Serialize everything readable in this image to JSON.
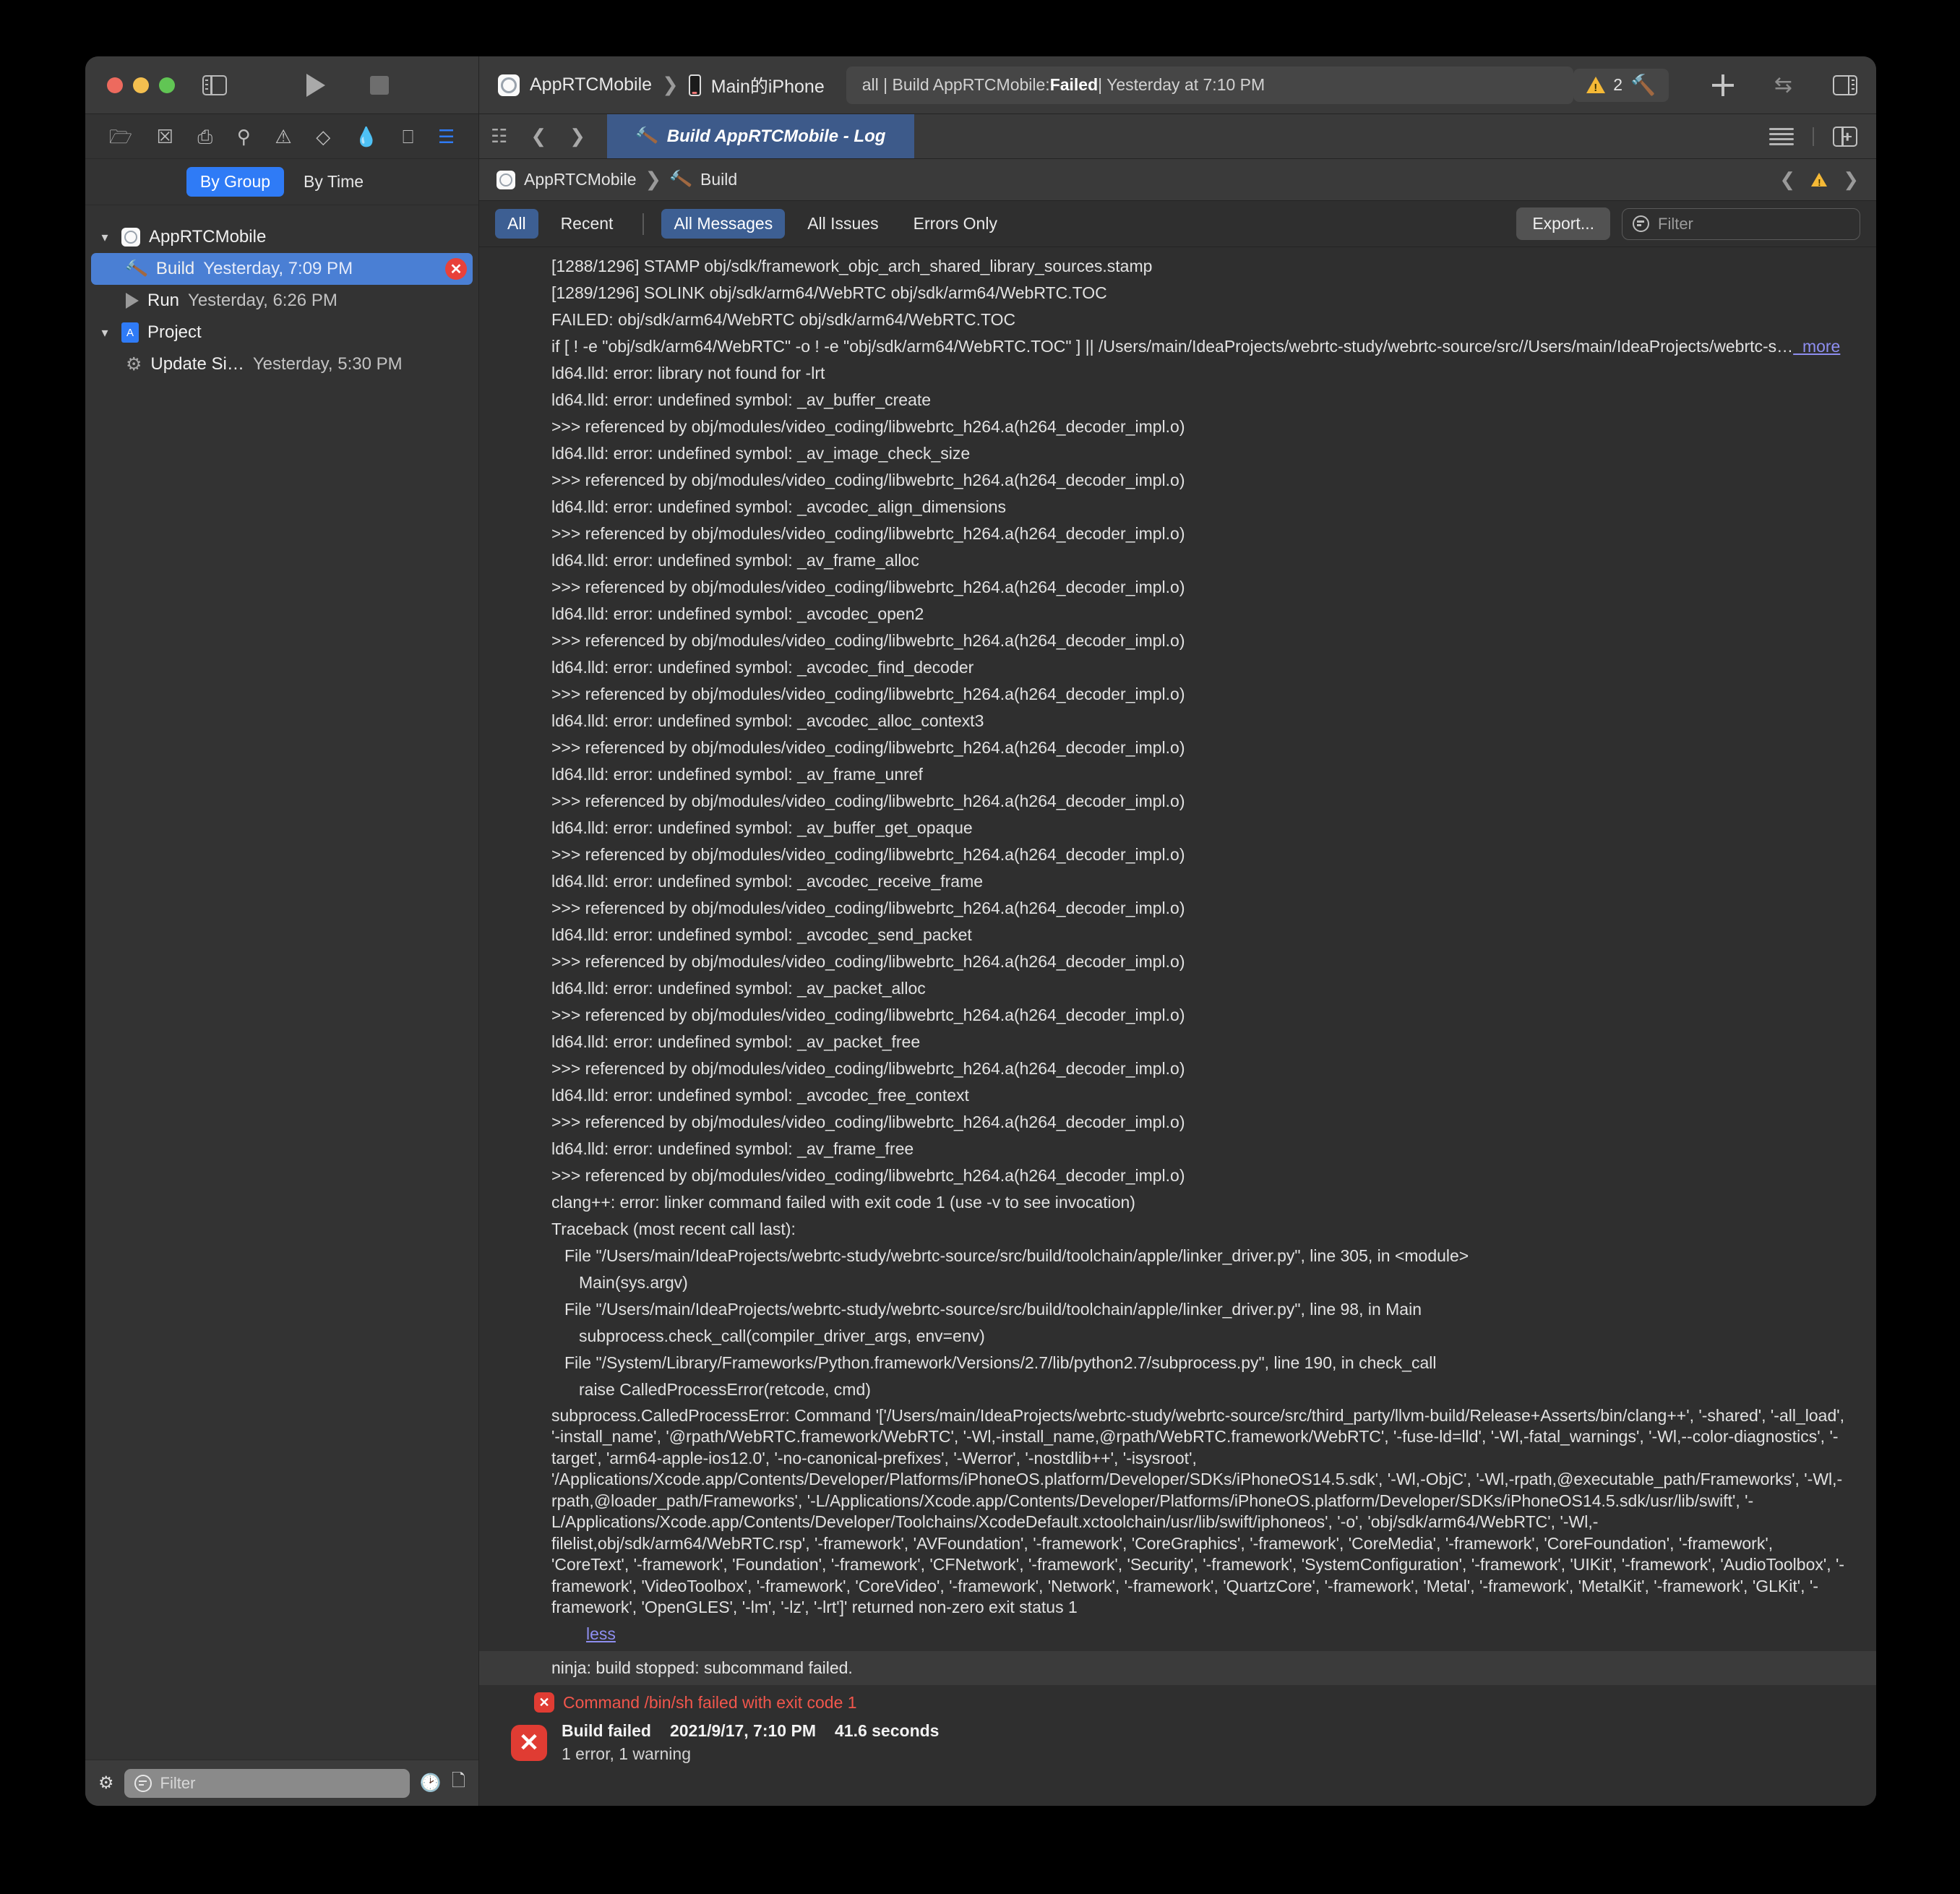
{
  "window": {
    "traffic_lights": [
      "close",
      "minimize",
      "zoom"
    ]
  },
  "toolbar": {
    "scheme_target": "AppRTCMobile",
    "scheme_device": "Main的iPhone",
    "status_prefix": "all | Build AppRTCMobile: ",
    "status_bold": "Failed",
    "status_suffix": " | Yesterday at 7:10 PM",
    "warning_count": "2",
    "icons": [
      "run-icon",
      "stop-icon",
      "sidebar-toggle-icon",
      "add-icon",
      "swap-icon",
      "inspector-toggle-icon",
      "hammer-icon",
      "warning-triangle-icon"
    ]
  },
  "sidebar": {
    "nav_icons": [
      "folder-icon",
      "source-control-icon",
      "symbol-hierarchy-icon",
      "search-icon",
      "warning-icon",
      "breakpoint-icon",
      "debug-icon",
      "tag-icon",
      "report-navigator-icon"
    ],
    "scope": {
      "by_group": "By Group",
      "by_time": "By Time",
      "selected": "By Group"
    },
    "tree": [
      {
        "label": "AppRTCMobile",
        "time": "",
        "icon": "app-icon",
        "level": 0,
        "expanded": true,
        "selected": false,
        "error": false
      },
      {
        "label": "Build",
        "time": "Yesterday, 7:09 PM",
        "icon": "hammer-icon",
        "level": 1,
        "expanded": false,
        "selected": true,
        "error": true
      },
      {
        "label": "Run",
        "time": "Yesterday, 6:26 PM",
        "icon": "play-icon",
        "level": 1,
        "expanded": false,
        "selected": false,
        "error": false
      },
      {
        "label": "Project",
        "time": "",
        "icon": "project-doc-icon",
        "level": 0,
        "expanded": true,
        "selected": false,
        "error": false
      },
      {
        "label": "Update Si…",
        "time": "Yesterday, 5:30 PM",
        "icon": "gear-icon",
        "level": 1,
        "expanded": false,
        "selected": false,
        "error": false
      }
    ],
    "bottom": {
      "filter_placeholder": "Filter",
      "icons": [
        "gear-icon",
        "filter-icon",
        "clock-icon",
        "document-icon"
      ]
    }
  },
  "editor": {
    "tab_label": "Build AppRTCMobile - Log",
    "tab_icon": "hammer-icon",
    "breadcrumb": [
      "AppRTCMobile",
      "Build"
    ],
    "filters": {
      "scope": [
        "All",
        "Recent"
      ],
      "scope_selected": "All",
      "level": [
        "All Messages",
        "All Issues",
        "Errors Only"
      ],
      "level_selected": "All Messages",
      "export_label": "Export...",
      "filter_placeholder": "Filter"
    }
  },
  "log": {
    "lines": [
      {
        "text": "[1288/1296] STAMP obj/sdk/framework_objc_arch_shared_library_sources.stamp",
        "style": "clip"
      },
      {
        "text": "[1289/1296] SOLINK obj/sdk/arm64/WebRTC obj/sdk/arm64/WebRTC.TOC",
        "style": "clip"
      },
      {
        "text": "FAILED: obj/sdk/arm64/WebRTC obj/sdk/arm64/WebRTC.TOC",
        "style": "clip"
      },
      {
        "text": "if [ ! -e \"obj/sdk/arm64/WebRTC\" -o ! -e \"obj/sdk/arm64/WebRTC.TOC\" ] || /Users/main/IdeaProjects/webrtc-study/webrtc-source/src//Users/main/IdeaProjects/webrtc-s…",
        "style": "clip",
        "more": "more"
      },
      {
        "text": "ld64.lld: error: library not found for -lrt",
        "style": "clip"
      },
      {
        "text": "ld64.lld: error: undefined symbol: _av_buffer_create",
        "style": "clip"
      },
      {
        "text": ">>> referenced by obj/modules/video_coding/libwebrtc_h264.a(h264_decoder_impl.o)",
        "style": "clip"
      },
      {
        "text": "ld64.lld: error: undefined symbol: _av_image_check_size",
        "style": "clip"
      },
      {
        "text": ">>> referenced by obj/modules/video_coding/libwebrtc_h264.a(h264_decoder_impl.o)",
        "style": "clip"
      },
      {
        "text": "ld64.lld: error: undefined symbol: _avcodec_align_dimensions",
        "style": "clip"
      },
      {
        "text": ">>> referenced by obj/modules/video_coding/libwebrtc_h264.a(h264_decoder_impl.o)",
        "style": "clip"
      },
      {
        "text": "ld64.lld: error: undefined symbol: _av_frame_alloc",
        "style": "clip"
      },
      {
        "text": ">>> referenced by obj/modules/video_coding/libwebrtc_h264.a(h264_decoder_impl.o)",
        "style": "clip"
      },
      {
        "text": "ld64.lld: error: undefined symbol: _avcodec_open2",
        "style": "clip"
      },
      {
        "text": ">>> referenced by obj/modules/video_coding/libwebrtc_h264.a(h264_decoder_impl.o)",
        "style": "clip"
      },
      {
        "text": "ld64.lld: error: undefined symbol: _avcodec_find_decoder",
        "style": "clip"
      },
      {
        "text": ">>> referenced by obj/modules/video_coding/libwebrtc_h264.a(h264_decoder_impl.o)",
        "style": "clip"
      },
      {
        "text": "ld64.lld: error: undefined symbol: _avcodec_alloc_context3",
        "style": "clip"
      },
      {
        "text": ">>> referenced by obj/modules/video_coding/libwebrtc_h264.a(h264_decoder_impl.o)",
        "style": "clip"
      },
      {
        "text": "ld64.lld: error: undefined symbol: _av_frame_unref",
        "style": "clip"
      },
      {
        "text": ">>> referenced by obj/modules/video_coding/libwebrtc_h264.a(h264_decoder_impl.o)",
        "style": "clip"
      },
      {
        "text": "ld64.lld: error: undefined symbol: _av_buffer_get_opaque",
        "style": "clip"
      },
      {
        "text": ">>> referenced by obj/modules/video_coding/libwebrtc_h264.a(h264_decoder_impl.o)",
        "style": "clip"
      },
      {
        "text": "ld64.lld: error: undefined symbol: _avcodec_receive_frame",
        "style": "clip"
      },
      {
        "text": ">>> referenced by obj/modules/video_coding/libwebrtc_h264.a(h264_decoder_impl.o)",
        "style": "clip"
      },
      {
        "text": "ld64.lld: error: undefined symbol: _avcodec_send_packet",
        "style": "clip"
      },
      {
        "text": ">>> referenced by obj/modules/video_coding/libwebrtc_h264.a(h264_decoder_impl.o)",
        "style": "clip"
      },
      {
        "text": "ld64.lld: error: undefined symbol: _av_packet_alloc",
        "style": "clip"
      },
      {
        "text": ">>> referenced by obj/modules/video_coding/libwebrtc_h264.a(h264_decoder_impl.o)",
        "style": "clip"
      },
      {
        "text": "ld64.lld: error: undefined symbol: _av_packet_free",
        "style": "clip"
      },
      {
        "text": ">>> referenced by obj/modules/video_coding/libwebrtc_h264.a(h264_decoder_impl.o)",
        "style": "clip"
      },
      {
        "text": "ld64.lld: error: undefined symbol: _avcodec_free_context",
        "style": "clip"
      },
      {
        "text": ">>> referenced by obj/modules/video_coding/libwebrtc_h264.a(h264_decoder_impl.o)",
        "style": "clip"
      },
      {
        "text": "ld64.lld: error: undefined symbol: _av_frame_free",
        "style": "clip"
      },
      {
        "text": ">>> referenced by obj/modules/video_coding/libwebrtc_h264.a(h264_decoder_impl.o)",
        "style": "clip"
      },
      {
        "text": "clang++: error: linker command failed with exit code 1 (use -v to see invocation)",
        "style": "clip"
      },
      {
        "text": "Traceback (most recent call last):",
        "style": "clip"
      },
      {
        "text": "File \"/Users/main/IdeaProjects/webrtc-study/webrtc-source/src/build/toolchain/apple/linker_driver.py\", line 305, in <module>",
        "style": "clip",
        "indent": 1
      },
      {
        "text": "Main(sys.argv)",
        "style": "clip",
        "indent": 2
      },
      {
        "text": "File \"/Users/main/IdeaProjects/webrtc-study/webrtc-source/src/build/toolchain/apple/linker_driver.py\", line 98, in Main",
        "style": "clip",
        "indent": 1
      },
      {
        "text": "subprocess.check_call(compiler_driver_args, env=env)",
        "style": "clip",
        "indent": 2
      },
      {
        "text": "File \"/System/Library/Frameworks/Python.framework/Versions/2.7/lib/python2.7/subprocess.py\", line 190, in check_call",
        "style": "clip",
        "indent": 1
      },
      {
        "text": "raise CalledProcessError(retcode, cmd)",
        "style": "clip",
        "indent": 2
      },
      {
        "text": "subprocess.CalledProcessError: Command '['/Users/main/IdeaProjects/webrtc-study/webrtc-source/src/third_party/llvm-build/Release+Asserts/bin/clang++', '-shared', '-all_load', '-install_name', '@rpath/WebRTC.framework/WebRTC', '-Wl,-install_name,@rpath/WebRTC.framework/WebRTC', '-fuse-ld=lld', '-Wl,-fatal_warnings', '-Wl,--color-diagnostics', '-target', 'arm64-apple-ios12.0', '-no-canonical-prefixes', '-Werror', '-nostdlib++', '-isysroot', '/Applications/Xcode.app/Contents/Developer/Platforms/iPhoneOS.platform/Developer/SDKs/iPhoneOS14.5.sdk', '-Wl,-ObjC', '-Wl,-rpath,@executable_path/Frameworks', '-Wl,-rpath,@loader_path/Frameworks', '-L/Applications/Xcode.app/Contents/Developer/Platforms/iPhoneOS.platform/Developer/SDKs/iPhoneOS14.5.sdk/usr/lib/swift', '-L/Applications/Xcode.app/Contents/Developer/Toolchains/XcodeDefault.xctoolchain/usr/lib/swift/iphoneos', '-o', 'obj/sdk/arm64/WebRTC', '-Wl,-filelist,obj/sdk/arm64/WebRTC.rsp', '-framework', 'AVFoundation', '-framework', 'CoreGraphics', '-framework', 'CoreMedia', '-framework', 'CoreFoundation', '-framework', 'CoreText', '-framework', 'Foundation', '-framework', 'CFNetwork', '-framework', 'Security', '-framework', 'SystemConfiguration', '-framework', 'UIKit', '-framework', 'AudioToolbox', '-framework', 'VideoToolbox', '-framework', 'CoreVideo', '-framework', 'Network', '-framework', 'QuartzCore', '-framework', 'Metal', '-framework', 'MetalKit', '-framework', 'GLKit', '-framework', 'OpenGLES', '-lm', '-lz', '-lrt']' returned non-zero exit status 1",
        "style": "wrap"
      }
    ],
    "less_link": "less",
    "ninja_line": "ninja: build stopped: subcommand failed.",
    "error_line": "Command /bin/sh failed with exit code 1",
    "summary": {
      "title": "Build failed",
      "timestamp": "2021/9/17, 7:10 PM",
      "duration": "41.6 seconds",
      "counts": "1 error, 1 warning"
    }
  },
  "colors": {
    "accent_blue": "#2f7bf6",
    "selected_row": "#4a7fd4",
    "tab_active": "#3d5a8a",
    "error_red": "#e03c33",
    "warning_yellow": "#f5b936",
    "link_purple": "#8e8ef0"
  }
}
